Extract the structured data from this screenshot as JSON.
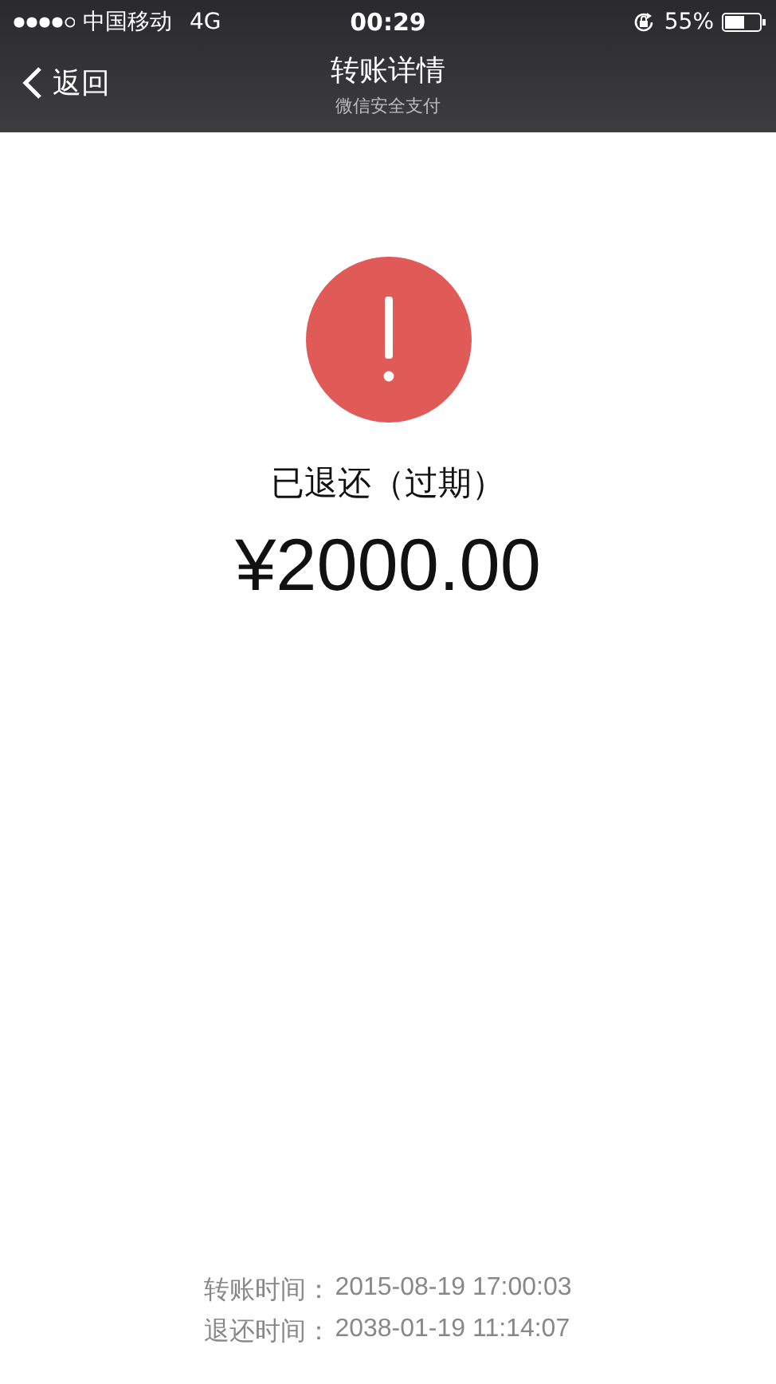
{
  "status_bar": {
    "carrier": "中国移动",
    "network": "4G",
    "time": "00:29",
    "battery": "55%"
  },
  "nav": {
    "back": "返回",
    "title": "转账详情",
    "subtitle": "微信安全支付"
  },
  "result": {
    "status": "已退还（过期）",
    "amount": "¥2000.00"
  },
  "details": [
    {
      "label": "转账时间：",
      "value": "2015-08-19 17:00:03"
    },
    {
      "label": "退还时间：",
      "value": "2038-01-19 11:14:07"
    }
  ]
}
